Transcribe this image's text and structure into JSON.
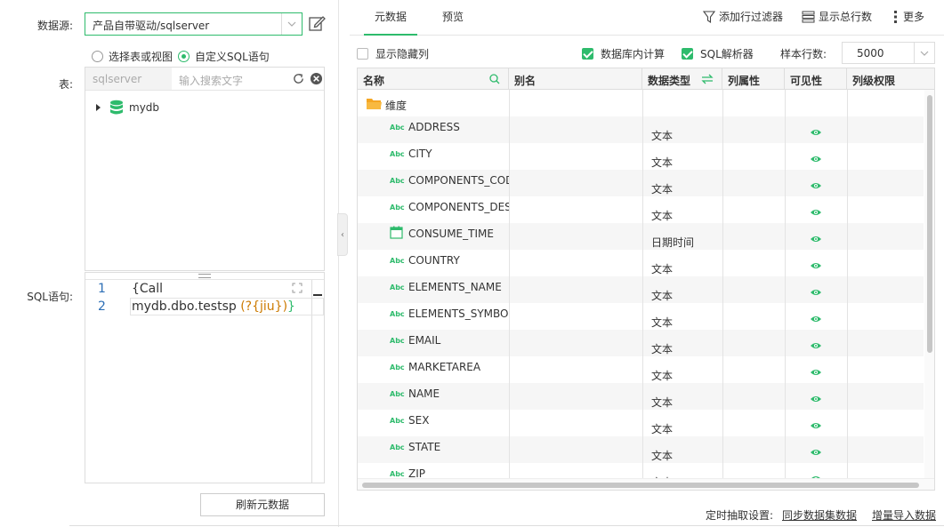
{
  "left": {
    "datasource_label": "数据源:",
    "datasource_value": "产品自带驱动/sqlserver",
    "radio_table": "选择表或视图",
    "radio_sql": "自定义SQL语句",
    "table_label": "表:",
    "schema_placeholder": "sqlserver",
    "search_placeholder": "输入搜索文字",
    "tree": [
      {
        "label": "mydb"
      }
    ],
    "sql_label": "SQL语句:",
    "sql_lines": [
      {
        "num": "1",
        "text": "{Call"
      },
      {
        "num": "2",
        "prefix": "mydb.dbo.testsp ",
        "param": "(?{jiu})",
        "suffix": "}"
      }
    ],
    "refresh_button": "刷新元数据"
  },
  "tabs": [
    {
      "label": "元数据",
      "active": true
    },
    {
      "label": "预览",
      "active": false
    }
  ],
  "toolbar": {
    "add_filter": "添加行过滤器",
    "show_rows": "显示总行数",
    "more": "更多"
  },
  "options": {
    "show_hidden": "显示隐藏列",
    "db_calc": "数据库内计算",
    "sql_parser": "SQL解析器",
    "sample_rows_label": "样本行数:",
    "sample_rows_value": "5000"
  },
  "grid": {
    "headers": [
      "名称",
      "别名",
      "数据类型",
      "列属性",
      "可见性",
      "列级权限"
    ],
    "folder": "维度",
    "rows": [
      {
        "name": "ADDRESS",
        "type": "文本",
        "icon": "abc"
      },
      {
        "name": "CITY",
        "type": "文本",
        "icon": "abc"
      },
      {
        "name": "COMPONENTS_CODE",
        "type": "文本",
        "icon": "abc"
      },
      {
        "name": "COMPONENTS_DESC",
        "type": "文本",
        "icon": "abc"
      },
      {
        "name": "CONSUME_TIME",
        "type": "日期时间",
        "icon": "calendar"
      },
      {
        "name": "COUNTRY",
        "type": "文本",
        "icon": "abc"
      },
      {
        "name": "ELEMENTS_NAME",
        "type": "文本",
        "icon": "abc"
      },
      {
        "name": "ELEMENTS_SYMBOL",
        "type": "文本",
        "icon": "abc"
      },
      {
        "name": "EMAIL",
        "type": "文本",
        "icon": "abc"
      },
      {
        "name": "MARKETAREA",
        "type": "文本",
        "icon": "abc"
      },
      {
        "name": "NAME",
        "type": "文本",
        "icon": "abc"
      },
      {
        "name": "SEX",
        "type": "文本",
        "icon": "abc"
      },
      {
        "name": "STATE",
        "type": "文本",
        "icon": "abc"
      },
      {
        "name": "ZIP",
        "type": "文本",
        "icon": "abc"
      }
    ],
    "abc_text": "Abc"
  },
  "footer": {
    "timing_label": "定时抽取设置:",
    "sync_link": "同步数据集数据",
    "incremental_link": "增量导入数据"
  },
  "colors": {
    "accent": "#2ebb6c",
    "folder": "#f5a623"
  }
}
